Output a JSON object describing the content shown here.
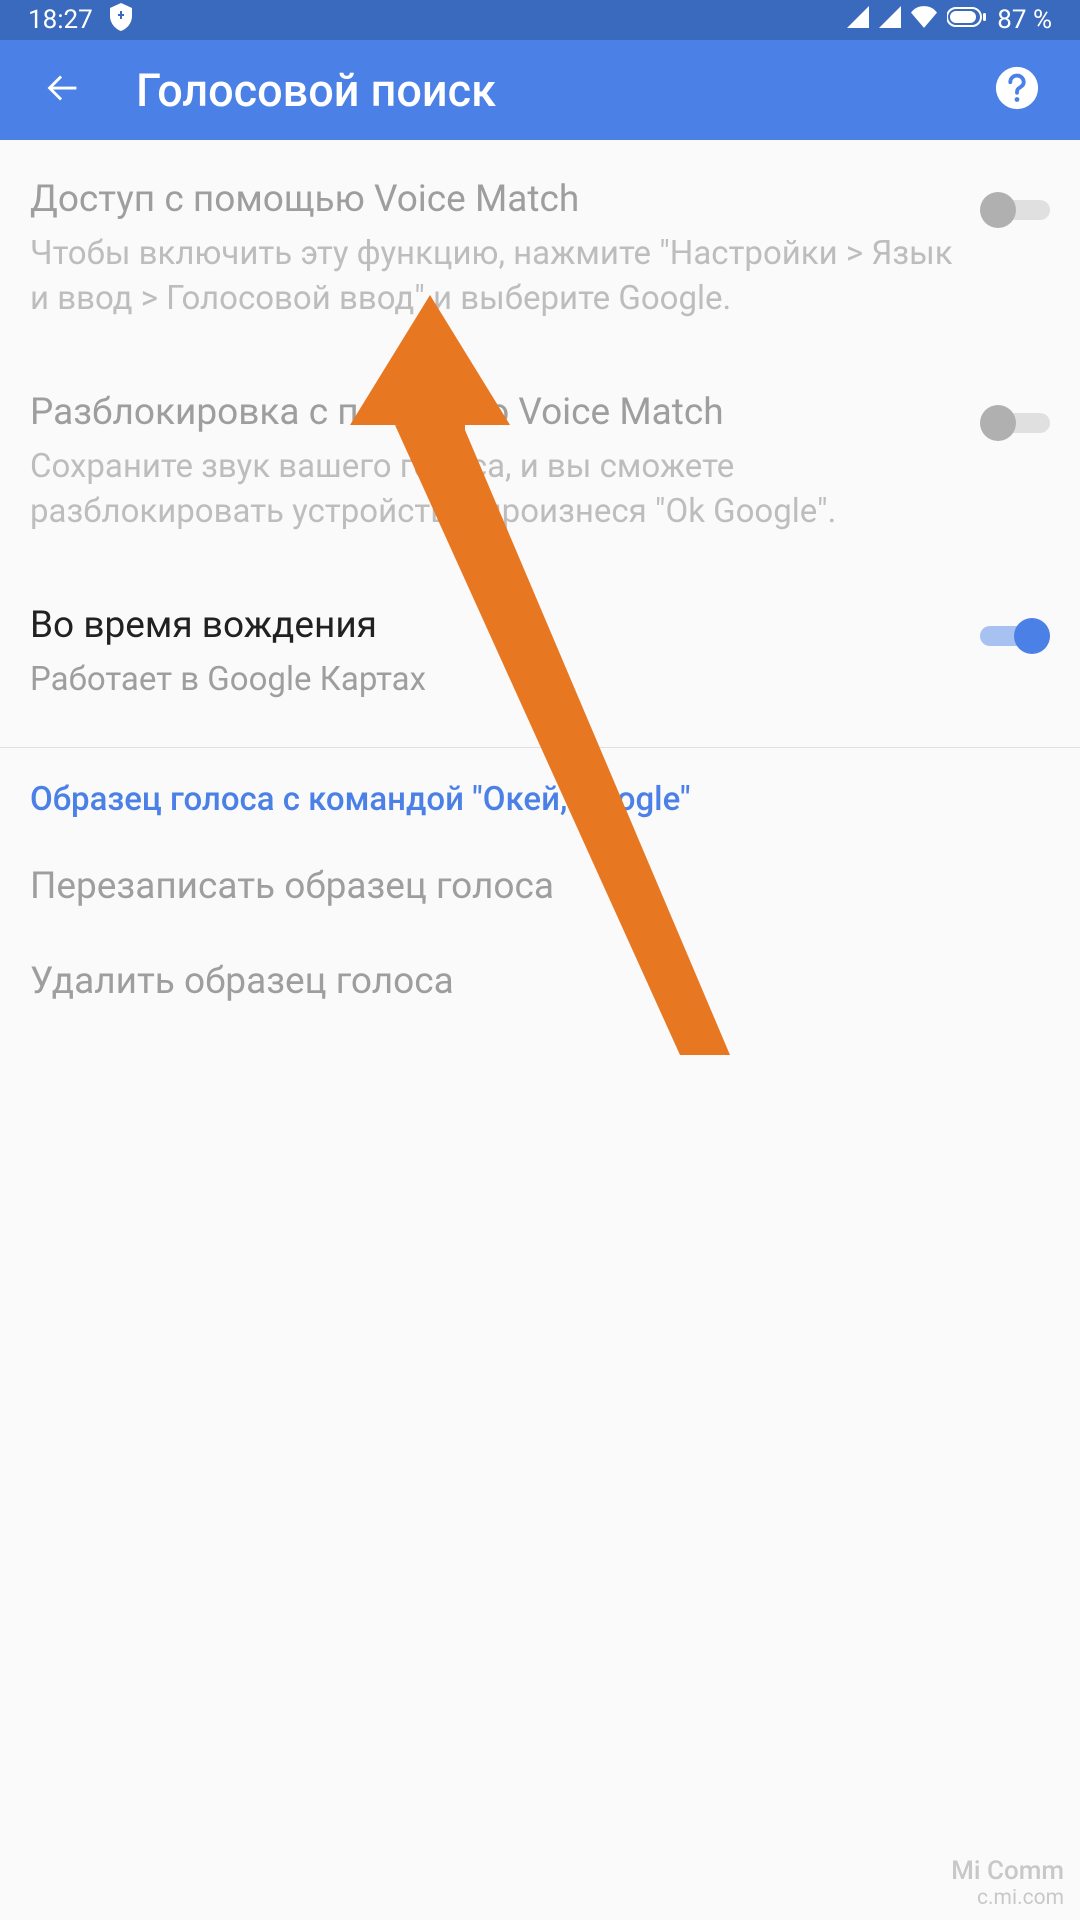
{
  "status_bar": {
    "time": "18:27",
    "battery_text": "87 %"
  },
  "app_bar": {
    "title": "Голосовой поиск"
  },
  "settings": {
    "voice_match_access": {
      "title": "Доступ с помощью Voice Match",
      "desc": "Чтобы включить эту функцию, нажмите \"Настройки > Язык и ввод > Голосовой ввод\" и выберите Google."
    },
    "voice_match_unlock": {
      "title": "Разблокировка с помощью Voice Match",
      "desc": "Сохраните звук вашего голоса, и вы сможете разблокировать устройство, произнеся \"Ok Google\"."
    },
    "while_driving": {
      "title": "Во время вождения",
      "desc": "Работает в Google Картах"
    }
  },
  "section": {
    "header": "Образец голоса с командой \"Окей, Google\"",
    "rerecord": "Перезаписать образец голоса",
    "delete": "Удалить образец голоса"
  },
  "watermark": {
    "text": "Mi Comm",
    "sub": "c.mi.com"
  },
  "colors": {
    "status_bg": "#3a6abd",
    "appbar_bg": "#4b80e6",
    "arrow": "#e87722"
  }
}
